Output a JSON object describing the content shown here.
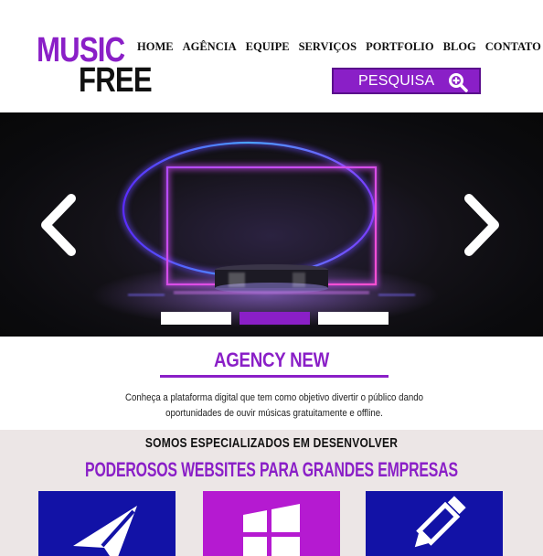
{
  "logo": {
    "line1": "MUSIC",
    "line2": "FREE"
  },
  "nav": {
    "items": [
      {
        "label": "HOME"
      },
      {
        "label": "AGÊNCIA"
      },
      {
        "label": "EQUIPE"
      },
      {
        "label": "SERVIÇOS"
      },
      {
        "label": "PORTFOLIO"
      },
      {
        "label": "BLOG"
      },
      {
        "label": "CONTATO"
      }
    ]
  },
  "search": {
    "label": "PESQUISA",
    "icon": "zoom-in-icon"
  },
  "hero": {
    "prev_icon": "chevron-left-icon",
    "next_icon": "chevron-right-icon",
    "active_slide": 2,
    "slide_count": 3
  },
  "intro": {
    "title": "AGENCY NEW",
    "text": "Conheça a plataforma digital que tem como objetivo divertir o público dando oportunidades de ouvir músicas gratuitamente e offline."
  },
  "services": {
    "subtitle": "SOMOS ESPECIALIZADOS EM DESENVOLVER",
    "title": "PODEROSOS WEBSITES PARA GRANDES EMPRESAS",
    "tiles": [
      {
        "icon": "paper-plane-icon",
        "color": "#1212a6"
      },
      {
        "icon": "windows-logo-icon",
        "color": "#b51ad1"
      },
      {
        "icon": "pencil-icon",
        "color": "#1212a6"
      }
    ]
  },
  "colors": {
    "accent": "#8a1fc7",
    "dark": "#111111",
    "band": "#ece6e6"
  }
}
